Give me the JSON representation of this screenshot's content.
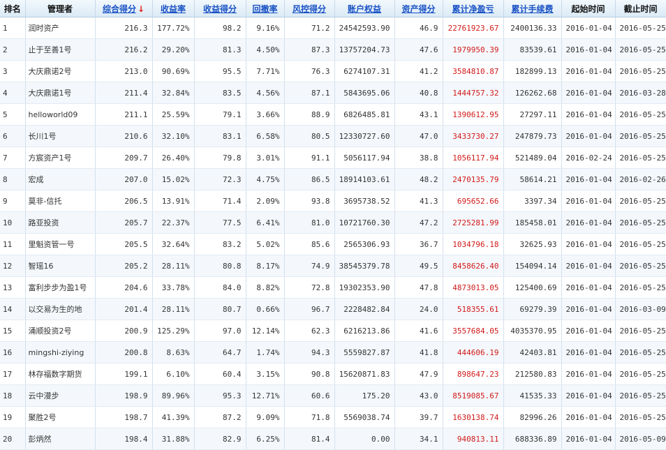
{
  "headers": {
    "rank": "排名",
    "manager": "管理者",
    "composite": "综合得分",
    "composite_arrow": "↓",
    "return_rate": "收益率",
    "return_score": "收益得分",
    "drawdown": "回撤率",
    "risk_score": "风控得分",
    "equity": "账户权益",
    "asset_score": "资产得分",
    "cum_pnl": "累计净盈亏",
    "cum_fee": "累计手续费",
    "start": "起始时间",
    "end": "截止时间"
  },
  "rows": [
    {
      "rank": "1",
      "manager": "润时资产",
      "composite": "216.3",
      "return_rate": "177.72%",
      "return_score": "98.2",
      "drawdown": "9.16%",
      "risk_score": "71.2",
      "equity": "24542593.90",
      "asset_score": "46.9",
      "cum_pnl": "22761923.67",
      "cum_fee": "2400136.33",
      "start": "2016-01-04",
      "end": "2016-05-25"
    },
    {
      "rank": "2",
      "manager": "止于至善1号",
      "composite": "216.2",
      "return_rate": "29.20%",
      "return_score": "81.3",
      "drawdown": "4.50%",
      "risk_score": "87.3",
      "equity": "13757204.73",
      "asset_score": "47.6",
      "cum_pnl": "1979950.39",
      "cum_fee": "83539.61",
      "start": "2016-01-04",
      "end": "2016-05-25"
    },
    {
      "rank": "3",
      "manager": "大庆鼎诺2号",
      "composite": "213.0",
      "return_rate": "90.69%",
      "return_score": "95.5",
      "drawdown": "7.71%",
      "risk_score": "76.3",
      "equity": "6274107.31",
      "asset_score": "41.2",
      "cum_pnl": "3584810.87",
      "cum_fee": "182899.13",
      "start": "2016-01-04",
      "end": "2016-05-25"
    },
    {
      "rank": "4",
      "manager": "大庆鼎诺1号",
      "composite": "211.4",
      "return_rate": "32.84%",
      "return_score": "83.5",
      "drawdown": "4.56%",
      "risk_score": "87.1",
      "equity": "5843695.06",
      "asset_score": "40.8",
      "cum_pnl": "1444757.32",
      "cum_fee": "126262.68",
      "start": "2016-01-04",
      "end": "2016-03-28"
    },
    {
      "rank": "5",
      "manager": "helloworld09",
      "composite": "211.1",
      "return_rate": "25.59%",
      "return_score": "79.1",
      "drawdown": "3.66%",
      "risk_score": "88.9",
      "equity": "6826485.81",
      "asset_score": "43.1",
      "cum_pnl": "1390612.95",
      "cum_fee": "27297.11",
      "start": "2016-01-04",
      "end": "2016-05-25"
    },
    {
      "rank": "6",
      "manager": "长川1号",
      "composite": "210.6",
      "return_rate": "32.10%",
      "return_score": "83.1",
      "drawdown": "6.58%",
      "risk_score": "80.5",
      "equity": "12330727.60",
      "asset_score": "47.0",
      "cum_pnl": "3433730.27",
      "cum_fee": "247879.73",
      "start": "2016-01-04",
      "end": "2016-05-25"
    },
    {
      "rank": "7",
      "manager": "方宸资产1号",
      "composite": "209.7",
      "return_rate": "26.40%",
      "return_score": "79.8",
      "drawdown": "3.01%",
      "risk_score": "91.1",
      "equity": "5056117.94",
      "asset_score": "38.8",
      "cum_pnl": "1056117.94",
      "cum_fee": "521489.04",
      "start": "2016-02-24",
      "end": "2016-05-25"
    },
    {
      "rank": "8",
      "manager": "宏成",
      "composite": "207.0",
      "return_rate": "15.02%",
      "return_score": "72.3",
      "drawdown": "4.75%",
      "risk_score": "86.5",
      "equity": "18914103.61",
      "asset_score": "48.2",
      "cum_pnl": "2470135.79",
      "cum_fee": "58614.21",
      "start": "2016-01-04",
      "end": "2016-02-26"
    },
    {
      "rank": "9",
      "manager": "莫非-信托",
      "composite": "206.5",
      "return_rate": "13.91%",
      "return_score": "71.4",
      "drawdown": "2.09%",
      "risk_score": "93.8",
      "equity": "3695738.52",
      "asset_score": "41.3",
      "cum_pnl": "695652.66",
      "cum_fee": "3397.34",
      "start": "2016-01-04",
      "end": "2016-05-25"
    },
    {
      "rank": "10",
      "manager": "路亚投资",
      "composite": "205.7",
      "return_rate": "22.37%",
      "return_score": "77.5",
      "drawdown": "6.41%",
      "risk_score": "81.0",
      "equity": "10721760.30",
      "asset_score": "47.2",
      "cum_pnl": "2725281.99",
      "cum_fee": "185458.01",
      "start": "2016-01-04",
      "end": "2016-05-25"
    },
    {
      "rank": "11",
      "manager": "里魁资管一号",
      "composite": "205.5",
      "return_rate": "32.64%",
      "return_score": "83.2",
      "drawdown": "5.02%",
      "risk_score": "85.6",
      "equity": "2565306.93",
      "asset_score": "36.7",
      "cum_pnl": "1034796.18",
      "cum_fee": "32625.93",
      "start": "2016-01-04",
      "end": "2016-05-25"
    },
    {
      "rank": "12",
      "manager": "智瑶16",
      "composite": "205.2",
      "return_rate": "28.11%",
      "return_score": "80.8",
      "drawdown": "8.17%",
      "risk_score": "74.9",
      "equity": "38545379.78",
      "asset_score": "49.5",
      "cum_pnl": "8458626.40",
      "cum_fee": "154094.14",
      "start": "2016-01-04",
      "end": "2016-05-25"
    },
    {
      "rank": "13",
      "manager": "富利步步为盈1号",
      "composite": "204.6",
      "return_rate": "33.78%",
      "return_score": "84.0",
      "drawdown": "8.82%",
      "risk_score": "72.8",
      "equity": "19302353.90",
      "asset_score": "47.8",
      "cum_pnl": "4873013.05",
      "cum_fee": "125400.69",
      "start": "2016-01-04",
      "end": "2016-05-25"
    },
    {
      "rank": "14",
      "manager": "以交易为生的地",
      "composite": "201.4",
      "return_rate": "28.11%",
      "return_score": "80.7",
      "drawdown": "0.66%",
      "risk_score": "96.7",
      "equity": "2228482.84",
      "asset_score": "24.0",
      "cum_pnl": "518355.61",
      "cum_fee": "69279.39",
      "start": "2016-01-04",
      "end": "2016-03-09"
    },
    {
      "rank": "15",
      "manager": "涌顺投资2号",
      "composite": "200.9",
      "return_rate": "125.29%",
      "return_score": "97.0",
      "drawdown": "12.14%",
      "risk_score": "62.3",
      "equity": "6216213.86",
      "asset_score": "41.6",
      "cum_pnl": "3557684.05",
      "cum_fee": "4035370.95",
      "start": "2016-01-04",
      "end": "2016-05-25"
    },
    {
      "rank": "16",
      "manager": "mingshi-ziying",
      "composite": "200.8",
      "return_rate": "8.63%",
      "return_score": "64.7",
      "drawdown": "1.74%",
      "risk_score": "94.3",
      "equity": "5559827.87",
      "asset_score": "41.8",
      "cum_pnl": "444606.19",
      "cum_fee": "42403.81",
      "start": "2016-01-04",
      "end": "2016-05-25"
    },
    {
      "rank": "17",
      "manager": "林存福数字期货",
      "composite": "199.1",
      "return_rate": "6.10%",
      "return_score": "60.4",
      "drawdown": "3.15%",
      "risk_score": "90.8",
      "equity": "15620871.83",
      "asset_score": "47.9",
      "cum_pnl": "898647.23",
      "cum_fee": "212580.83",
      "start": "2016-01-04",
      "end": "2016-05-25"
    },
    {
      "rank": "18",
      "manager": "云中漫步",
      "composite": "198.9",
      "return_rate": "89.96%",
      "return_score": "95.3",
      "drawdown": "12.71%",
      "risk_score": "60.6",
      "equity": "175.20",
      "asset_score": "43.0",
      "cum_pnl": "8519085.67",
      "cum_fee": "41535.33",
      "start": "2016-01-04",
      "end": "2016-05-25"
    },
    {
      "rank": "19",
      "manager": "聚胜2号",
      "composite": "198.7",
      "return_rate": "41.39%",
      "return_score": "87.2",
      "drawdown": "9.09%",
      "risk_score": "71.8",
      "equity": "5569038.74",
      "asset_score": "39.7",
      "cum_pnl": "1630138.74",
      "cum_fee": "82996.26",
      "start": "2016-01-04",
      "end": "2016-05-25"
    },
    {
      "rank": "20",
      "manager": "彭炳然",
      "composite": "198.4",
      "return_rate": "31.88%",
      "return_score": "82.9",
      "drawdown": "6.25%",
      "risk_score": "81.4",
      "equity": "0.00",
      "asset_score": "34.1",
      "cum_pnl": "940813.11",
      "cum_fee": "688336.89",
      "start": "2016-01-04",
      "end": "2016-05-09"
    }
  ]
}
